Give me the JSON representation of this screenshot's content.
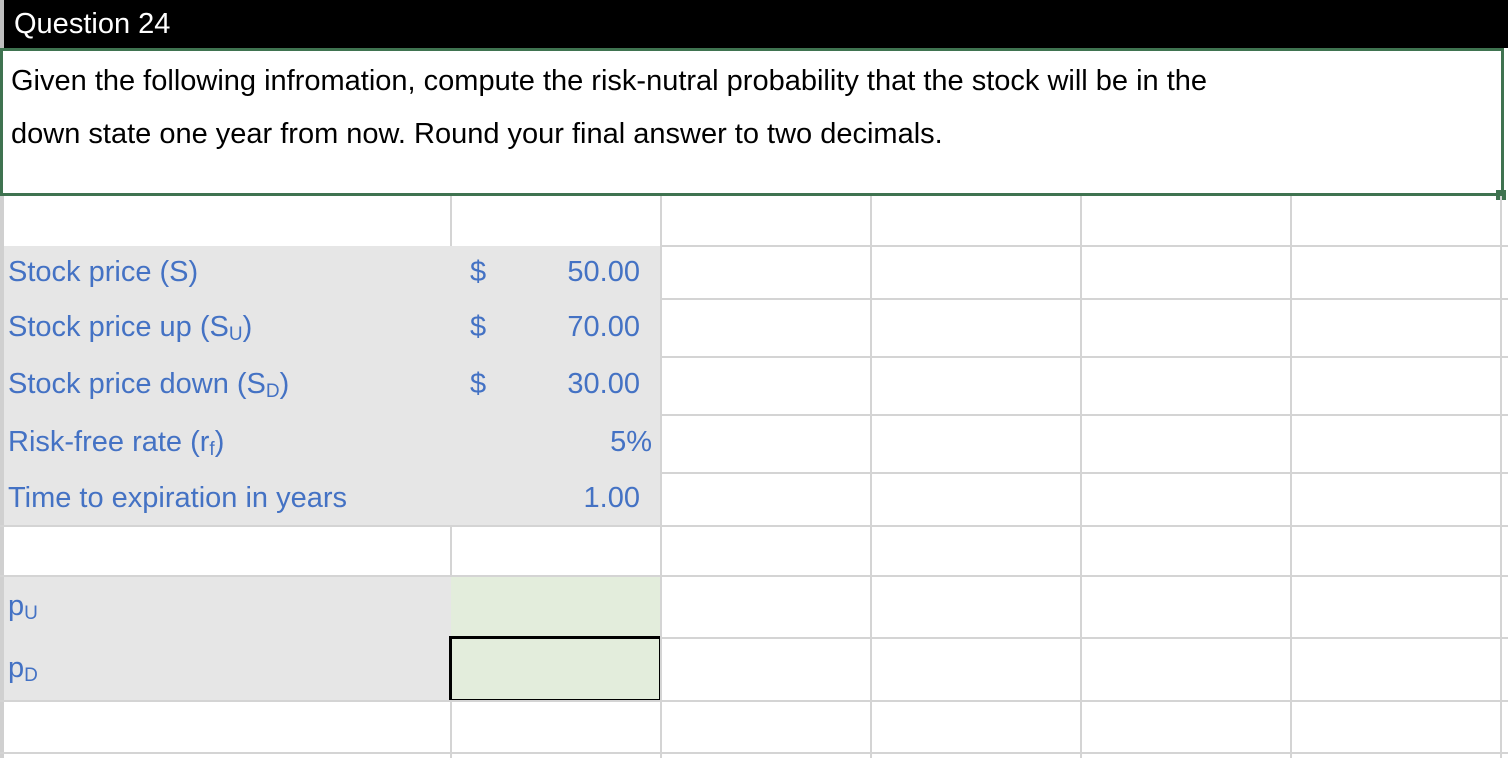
{
  "sheet": {
    "title": "Question 24",
    "question_line1": "Given the following infromation, compute the risk-nutral probability that the stock will be in the",
    "question_line2": "down state one year from now. Round your final answer to two decimals."
  },
  "inputs": [
    {
      "label": "Stock price (S)",
      "label_base": "Stock price (S)",
      "sub": "",
      "label_tail": "",
      "currency": "$",
      "value": "50.00"
    },
    {
      "label_base": "Stock price up (S",
      "sub": "U",
      "label_tail": ")",
      "currency": "$",
      "value": "70.00"
    },
    {
      "label_base": "Stock price down (S",
      "sub": "D",
      "label_tail": ")",
      "currency": "$",
      "value": "30.00"
    },
    {
      "label_base": "Risk-free rate (r",
      "sub": "f",
      "label_tail": ")",
      "currency": "",
      "value": "5%"
    },
    {
      "label_base": "Time to expiration in years",
      "sub": "",
      "label_tail": "",
      "currency": "",
      "value": "1.00"
    }
  ],
  "outputs": [
    {
      "label_base": "p",
      "sub": "U",
      "value": ""
    },
    {
      "label_base": "p",
      "sub": "D",
      "value": ""
    }
  ],
  "colors": {
    "label_text": "#4472c4",
    "input_fill": "#e6e6e6",
    "answer_fill": "#e3eddc",
    "selection_border": "#3f7350",
    "gridline": "#d4d4d4"
  }
}
